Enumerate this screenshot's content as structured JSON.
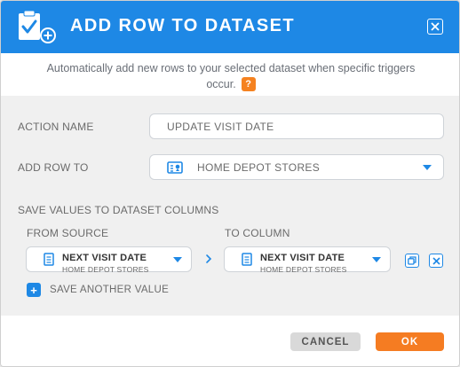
{
  "dialog": {
    "title": "ADD ROW TO DATASET",
    "intro_line1": "Automatically add new rows to your selected dataset when specific triggers",
    "intro_line2": "occur.",
    "help_label": "?"
  },
  "form": {
    "action_name_label": "ACTION NAME",
    "action_name_value": "UPDATE VISIT DATE",
    "add_row_to_label": "ADD ROW TO",
    "add_row_to_value": "HOME DEPOT STORES",
    "save_values_heading": "SAVE VALUES TO DATASET COLUMNS",
    "from_source_label": "FROM SOURCE",
    "to_column_label": "TO COLUMN",
    "source": {
      "column": "NEXT VISIT DATE",
      "dataset": "HOME DEPOT STORES"
    },
    "target": {
      "column": "NEXT VISIT DATE",
      "dataset": "HOME DEPOT STORES"
    },
    "save_another_label": "SAVE ANOTHER VALUE"
  },
  "footer": {
    "cancel_label": "CANCEL",
    "ok_label": "OK"
  },
  "colors": {
    "accent": "#1e88e5",
    "primary_button": "#f57c22",
    "help_badge": "#f58220"
  }
}
